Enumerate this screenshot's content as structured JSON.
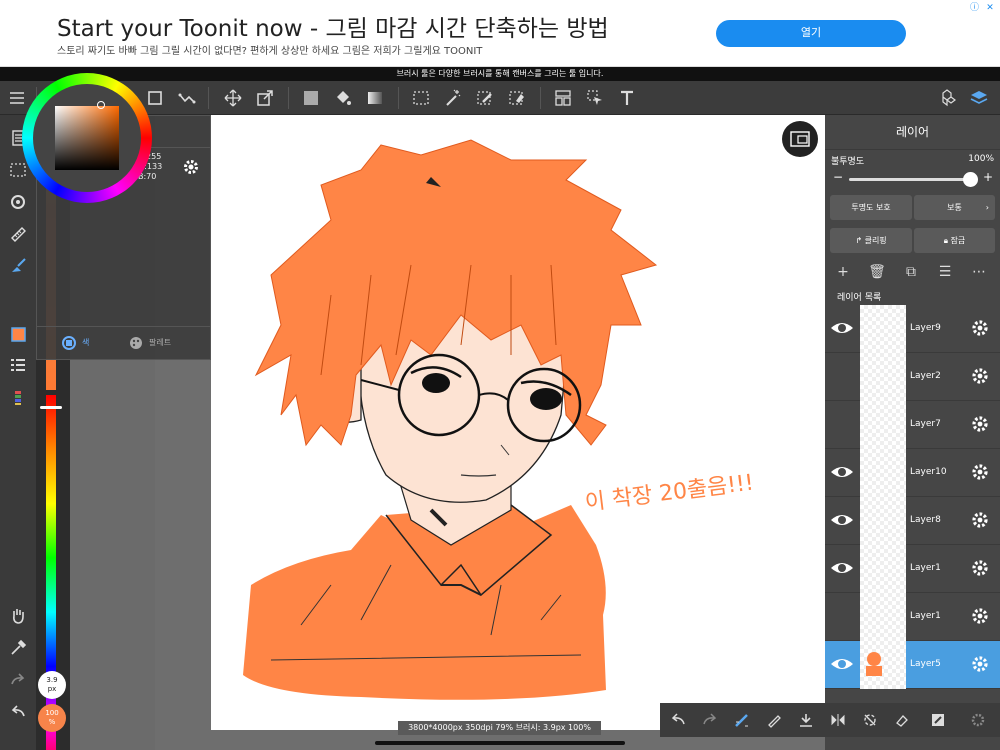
{
  "ad": {
    "title": "Start your Toonit now - 그림 마감 시간 단축하는 방법",
    "subtitle": "스토리 짜기도 바빠 그림 그릴 시간이 없다면? 편하게 상상만 하세요 그림은 저희가 그릴게요 TOONIT",
    "button": "열기",
    "badge": "ⓘ",
    "close": "✕"
  },
  "tip": "브러시 툴은 다양한 브러시를 통해 캔버스를 그리는 툴 입니다.",
  "toolbar": {
    "icons": [
      "menu-icon",
      "brush-icon",
      "eraser-icon",
      "blur-icon",
      "shape-icon",
      "correction-icon",
      "move-icon",
      "transform-icon",
      "fill-rect-icon",
      "bucket-icon",
      "gradient-icon",
      "select-icon",
      "magic-wand-icon",
      "select-pen-icon",
      "select-eraser-icon",
      "frame-icon",
      "pointer-icon",
      "text-icon",
      "material-icon",
      "layers-icon"
    ]
  },
  "color_panel": {
    "title": "색",
    "r": "R:255",
    "g": "G:133",
    "b": "B:70",
    "current_color": "#ff8546",
    "tab_color": "색",
    "tab_palette": "팔레트"
  },
  "brush": {
    "size": "3.9",
    "size_unit": "px",
    "opacity": "100",
    "opacity_unit": "%"
  },
  "canvas": {
    "handwriting": "이 착장 20출음!!!",
    "status": "3800*4000px 350dpi 79% 브러시: 3.9px 100%"
  },
  "layer_panel": {
    "title": "레이어",
    "opacity_label": "불투명도",
    "opacity_value": "100%",
    "opacity_fraction": 1.0,
    "protect_alpha": "투명도 보호",
    "blend_mode": "보통",
    "clipping": "클리핑",
    "lock": "잠금",
    "list_label": "레이어 목록",
    "layers": [
      {
        "name": "Layer9",
        "visible": true,
        "selected": false
      },
      {
        "name": "Layer2",
        "visible": false,
        "selected": false
      },
      {
        "name": "Layer7",
        "visible": false,
        "selected": false
      },
      {
        "name": "Layer10",
        "visible": true,
        "selected": false
      },
      {
        "name": "Layer8",
        "visible": true,
        "selected": false
      },
      {
        "name": "Layer1",
        "visible": true,
        "selected": false
      },
      {
        "name": "Layer1",
        "visible": false,
        "selected": false
      },
      {
        "name": "Layer5",
        "visible": true,
        "selected": true
      }
    ]
  },
  "colors": {
    "accent": "#4a9ee0",
    "orange": "#ff8546",
    "ad_button": "#1a8cf0"
  }
}
